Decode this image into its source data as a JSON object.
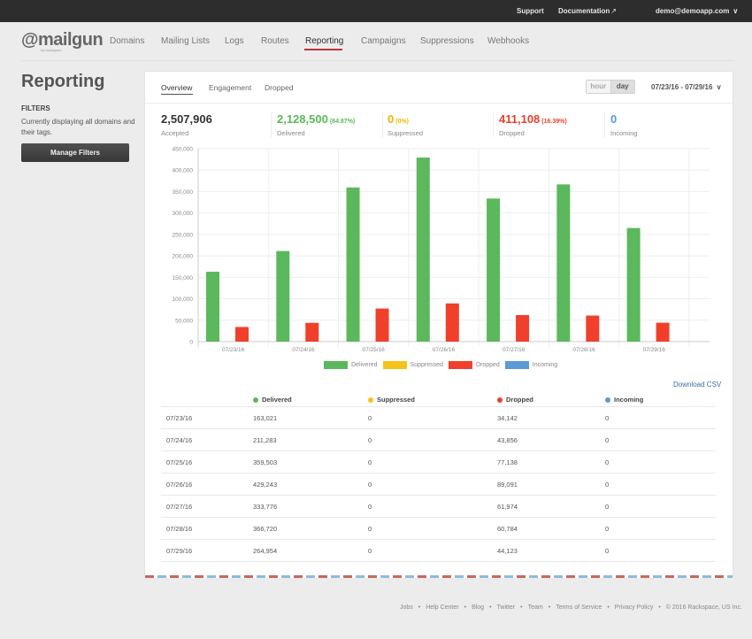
{
  "topbar": {
    "support": "Support",
    "documentation": "Documentation",
    "external_icon": "↗",
    "user": "demo@demoapp.com",
    "chevron": "⌄"
  },
  "logo": {
    "text": "@mailgun",
    "sub": "by rackspace"
  },
  "nav": {
    "items": [
      "Domains",
      "Mailing Lists",
      "Logs",
      "Routes",
      "Reporting",
      "Campaigns",
      "Suppressions",
      "Webhooks"
    ],
    "active": "Reporting"
  },
  "sidebar": {
    "title": "Reporting",
    "filters_heading": "FILTERS",
    "filters_text": "Currently displaying all domains and their tags.",
    "manage_button": "Manage Filters"
  },
  "panel": {
    "tabs": [
      "Overview",
      "Engagement",
      "Dropped"
    ],
    "active_tab": "Overview",
    "granularity": {
      "hour": "hour",
      "day": "day",
      "selected": "day"
    },
    "date_range": "07/23/16 - 07/29/16",
    "stats": [
      {
        "value": "2,507,906",
        "pct": "",
        "label": "Accepted",
        "color": "#333333"
      },
      {
        "value": "2,128,500",
        "pct": "(84.87%)",
        "label": "Delivered",
        "color": "#5cb85c"
      },
      {
        "value": "0",
        "pct": "(0%)",
        "label": "Suppressed",
        "color": "#f0b400"
      },
      {
        "value": "411,108",
        "pct": "(16.39%)",
        "label": "Dropped",
        "color": "#e8402d"
      },
      {
        "value": "0",
        "pct": "",
        "label": "Incoming",
        "color": "#5a9bd5"
      }
    ],
    "download_csv": "Download CSV"
  },
  "chart_data": {
    "type": "bar",
    "categories": [
      "07/23/16",
      "07/24/16",
      "07/25/16",
      "07/26/16",
      "07/27/16",
      "07/28/16",
      "07/29/16"
    ],
    "series": [
      {
        "name": "Delivered",
        "color": "#5cb85c",
        "values": [
          163021,
          211283,
          359503,
          429243,
          333776,
          366720,
          264954
        ]
      },
      {
        "name": "Suppressed",
        "color": "#f6c21c",
        "values": [
          0,
          0,
          0,
          0,
          0,
          0,
          0
        ]
      },
      {
        "name": "Dropped",
        "color": "#f0402b",
        "values": [
          34142,
          43856,
          77138,
          89091,
          61974,
          60784,
          44123
        ]
      },
      {
        "name": "Incoming",
        "color": "#5a9bd5",
        "values": [
          0,
          0,
          0,
          0,
          0,
          0,
          0
        ]
      }
    ],
    "yticks": [
      "0",
      "50,000",
      "100,000",
      "150,000",
      "200,000",
      "250,000",
      "300,000",
      "350,000",
      "400,000",
      "450,000"
    ],
    "ylim": [
      0,
      450000
    ],
    "grid": true,
    "legend": "bottom",
    "title": "",
    "xlabel": "",
    "ylabel": ""
  },
  "table": {
    "headers": [
      "",
      "Delivered",
      "Suppressed",
      "Dropped",
      "Incoming"
    ],
    "header_colors": [
      "",
      "#5cb85c",
      "#f6c21c",
      "#f0402b",
      "#5a9bd5"
    ],
    "rows": [
      [
        "07/23/16",
        "163,021",
        "0",
        "34,142",
        "0"
      ],
      [
        "07/24/16",
        "211,283",
        "0",
        "43,856",
        "0"
      ],
      [
        "07/25/16",
        "359,503",
        "0",
        "77,138",
        "0"
      ],
      [
        "07/26/16",
        "429,243",
        "0",
        "89,091",
        "0"
      ],
      [
        "07/27/16",
        "333,776",
        "0",
        "61,974",
        "0"
      ],
      [
        "07/28/16",
        "366,720",
        "0",
        "60,784",
        "0"
      ],
      [
        "07/29/16",
        "264,954",
        "0",
        "44,123",
        "0"
      ]
    ]
  },
  "footer": {
    "links": [
      "Jobs",
      "Help Center",
      "Blog",
      "Twitter",
      "Team",
      "Terms of Service",
      "Privacy Policy"
    ],
    "copyright": "© 2016 Rackspace, US Inc."
  }
}
